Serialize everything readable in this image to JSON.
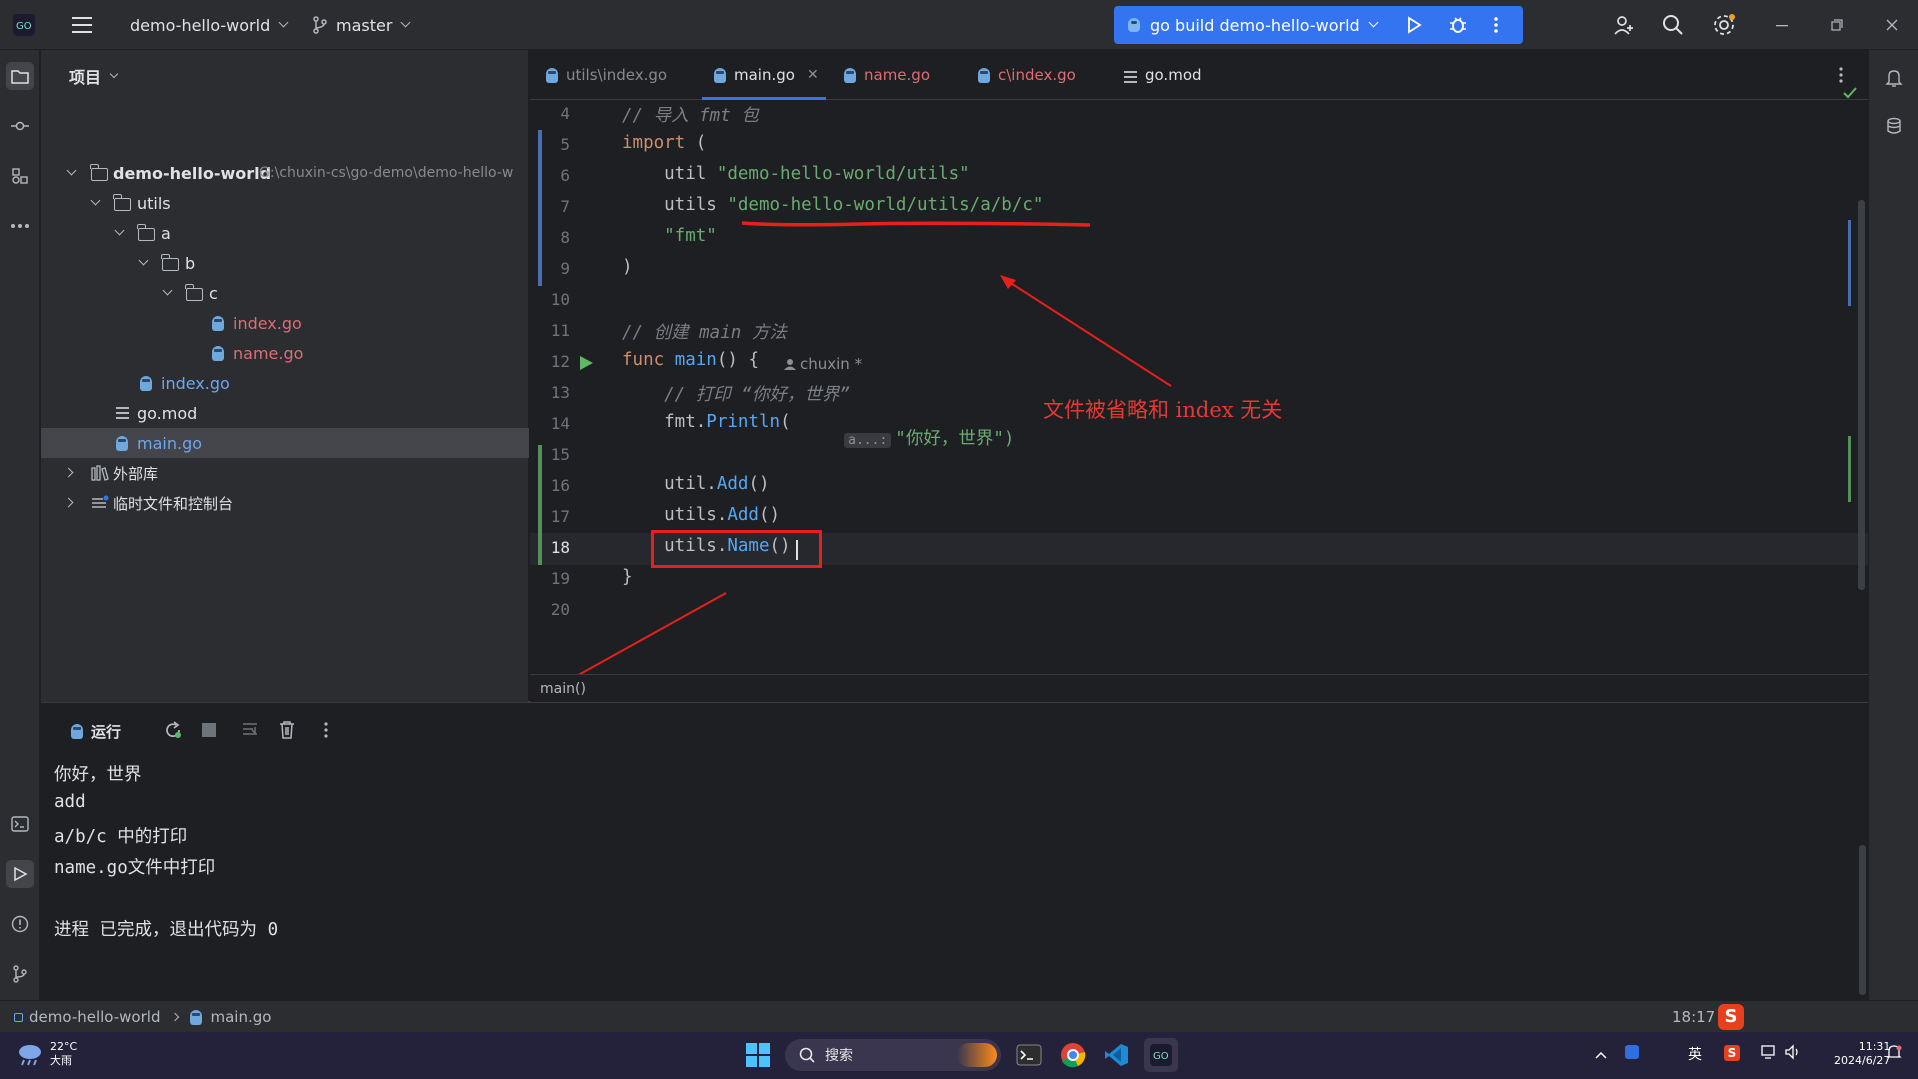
{
  "titlebar": {
    "project_name": "demo-hello-world",
    "branch": "master",
    "run_config": "go build demo-hello-world"
  },
  "project_panel": {
    "header": "项目",
    "root_name": "demo-hello-world",
    "root_path": "G:\\chuxin-cs\\go-demo\\demo-hello-w",
    "items": [
      {
        "label": "utils"
      },
      {
        "label": "a"
      },
      {
        "label": "b"
      },
      {
        "label": "c"
      },
      {
        "label": "index.go"
      },
      {
        "label": "name.go"
      },
      {
        "label": "index.go"
      },
      {
        "label": "go.mod"
      },
      {
        "label": "main.go"
      },
      {
        "label": "外部库"
      },
      {
        "label": "临时文件和控制台"
      }
    ]
  },
  "tabs": [
    {
      "label": "utils\\index.go"
    },
    {
      "label": "main.go"
    },
    {
      "label": "name.go"
    },
    {
      "label": "c\\index.go"
    },
    {
      "label": "go.mod"
    }
  ],
  "editor": {
    "lines": [
      {
        "num": "4",
        "tokens": [
          [
            "cm",
            "// 导入 fmt 包"
          ]
        ]
      },
      {
        "num": "5",
        "tokens": [
          [
            "kw",
            "import"
          ],
          [
            "pkg",
            " ("
          ]
        ]
      },
      {
        "num": "6",
        "tokens": [
          [
            "pkg",
            "    util "
          ],
          [
            "str",
            "\"demo-hello-world/utils\""
          ]
        ]
      },
      {
        "num": "7",
        "tokens": [
          [
            "pkg",
            "    utils "
          ],
          [
            "str",
            "\"demo-hello-world/utils/a/b/c\""
          ]
        ]
      },
      {
        "num": "8",
        "tokens": [
          [
            "str",
            "    \"fmt\""
          ]
        ]
      },
      {
        "num": "9",
        "tokens": [
          [
            "pkg",
            ")"
          ]
        ]
      },
      {
        "num": "10",
        "tokens": []
      },
      {
        "num": "11",
        "tokens": [
          [
            "cm",
            "// 创建 main 方法"
          ]
        ]
      },
      {
        "num": "12",
        "tokens": [
          [
            "kw",
            "func"
          ],
          [
            "pkg",
            " "
          ],
          [
            "fn",
            "main"
          ],
          [
            "pkg",
            "() {"
          ]
        ]
      },
      {
        "num": "13",
        "tokens": [
          [
            "cm",
            "    // 打印 “你好，世界”"
          ]
        ]
      },
      {
        "num": "14",
        "tokens": [
          [
            "pkg",
            "    fmt."
          ],
          [
            "fn",
            "Println"
          ],
          [
            "pkg",
            "("
          ]
        ]
      },
      {
        "num": "15",
        "tokens": []
      },
      {
        "num": "16",
        "tokens": [
          [
            "pkg",
            "    util."
          ],
          [
            "fn",
            "Add"
          ],
          [
            "pkg",
            "()"
          ]
        ]
      },
      {
        "num": "17",
        "tokens": [
          [
            "pkg",
            "    utils."
          ],
          [
            "fn",
            "Add"
          ],
          [
            "pkg",
            "()"
          ]
        ]
      },
      {
        "num": "18",
        "tokens": [
          [
            "pkg",
            "    utils."
          ],
          [
            "fn",
            "Name"
          ],
          [
            "pkg",
            "()"
          ]
        ]
      },
      {
        "num": "19",
        "tokens": [
          [
            "pkg",
            "}"
          ]
        ]
      },
      {
        "num": "20",
        "tokens": []
      }
    ],
    "line14_hint": "a...:",
    "line14_string": "\"你好，世界\")",
    "author_hint": "chuxin *",
    "function_breadcrumb": "main()"
  },
  "annotation": "文件被省略和 index 无关",
  "run_panel": {
    "tab_label": "运行",
    "output": [
      "你好，世界",
      "add",
      "a/b/c 中的打印",
      "name.go文件中打印",
      "",
      "进程 已完成，退出代码为 0"
    ]
  },
  "statusbar": {
    "crumb_project": "demo-hello-world",
    "crumb_file": "main.go",
    "cursor_pos": "18:17"
  },
  "taskbar": {
    "weather_temp": "22°C",
    "weather_desc": "大雨",
    "search_placeholder": "搜索",
    "ime": "英",
    "time": "11:31",
    "date": "2024/6/27"
  },
  "colors": {
    "accent": "#3574f0",
    "annotation_red": "#e53935"
  }
}
